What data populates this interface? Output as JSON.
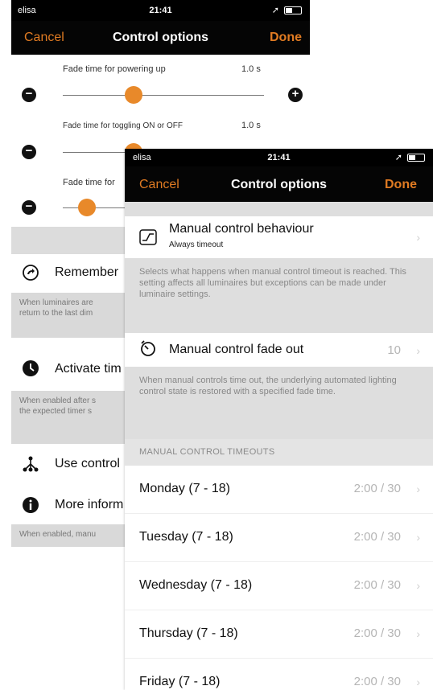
{
  "back_screen": {
    "status": {
      "carrier": "elisa",
      "time": "21:41"
    },
    "nav": {
      "cancel": "Cancel",
      "title": "Control options",
      "done": "Done"
    },
    "fade_rows": [
      {
        "label": "Fade time for powering up",
        "value": "1.0 s",
        "level": 0.35
      },
      {
        "label": "Fade time for toggling ON or OFF",
        "value": "1.0 s",
        "level": 0.35
      },
      {
        "label": "Fade time for",
        "value": "",
        "level": 0.12
      }
    ],
    "rows": [
      {
        "label": "Remember",
        "icon": "redo-circle-icon"
      },
      {
        "label": "Activate tim",
        "icon": "clock-icon"
      },
      {
        "label": "Use control",
        "icon": "network-icon"
      },
      {
        "label": "More inform",
        "icon": "info-icon"
      }
    ],
    "notes": {
      "remember": [
        "When luminaires are",
        "return to the last dim"
      ],
      "activate": [
        "When enabled after s",
        "the expected timer s"
      ],
      "more": [
        "When enabled, manu"
      ]
    }
  },
  "front_screen": {
    "status": {
      "carrier": "elisa",
      "time": "21:41"
    },
    "nav": {
      "cancel": "Cancel",
      "title": "Control options",
      "done": "Done"
    },
    "manual_behaviour": {
      "title": "Manual control behaviour",
      "subtitle": "Always timeout",
      "note": "Selects what happens when manual control timeout is reached. This setting affects all luminaires but exceptions can be made under luminaire settings."
    },
    "fade_out": {
      "title": "Manual control fade out",
      "value": "10",
      "note": "When manual controls time out, the underlying automated lighting control state is restored with a specified fade time."
    },
    "timeouts_header": "MANUAL CONTROL TIMEOUTS",
    "days": [
      {
        "label": "Monday (7 - 18)",
        "value": "2:00 / 30"
      },
      {
        "label": "Tuesday (7 - 18)",
        "value": "2:00 / 30"
      },
      {
        "label": "Wednesday (7 - 18)",
        "value": "2:00 / 30"
      },
      {
        "label": "Thursday (7 - 18)",
        "value": "2:00 / 30"
      },
      {
        "label": "Friday (7 - 18)",
        "value": "2:00 / 30"
      }
    ]
  },
  "colors": {
    "accent": "#e07b22",
    "knob": "#e8892a",
    "bar": "#050505"
  }
}
